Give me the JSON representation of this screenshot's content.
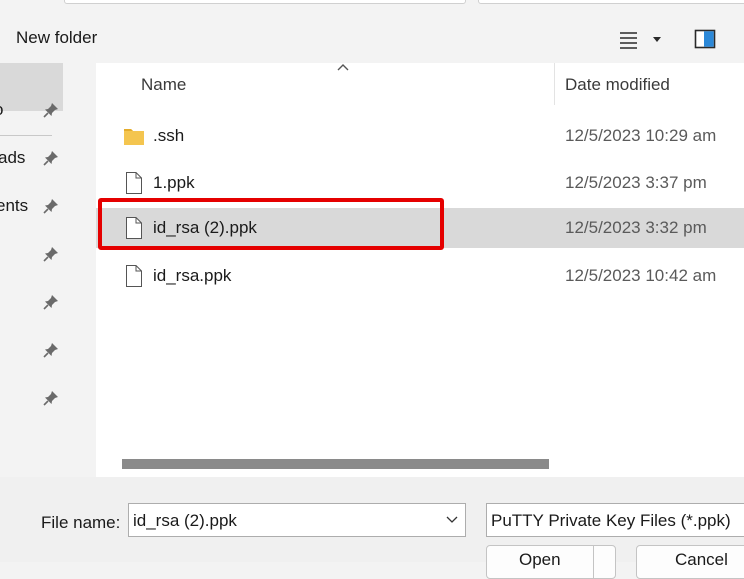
{
  "toolbar": {
    "new_folder_label": "New folder",
    "view_icon": "list-view-icon",
    "dropdown_icon": "caret-down-icon",
    "preview_pane_icon": "preview-pane-icon"
  },
  "nav": {
    "items": [
      {
        "label": "o",
        "icon": "pin-icon"
      },
      {
        "label": "ads",
        "icon": "pin-icon"
      },
      {
        "label": "ents",
        "icon": "pin-icon"
      },
      {
        "label": "",
        "icon": "pin-icon"
      },
      {
        "label": "",
        "icon": "pin-icon"
      },
      {
        "label": "",
        "icon": "pin-icon"
      },
      {
        "label": "",
        "icon": "pin-icon"
      }
    ]
  },
  "file_list": {
    "columns": [
      "Name",
      "Date modified"
    ],
    "rows": [
      {
        "name": ".ssh",
        "date": "12/5/2023 10:29 am",
        "icon": "folder-icon",
        "selected": false
      },
      {
        "name": "1.ppk",
        "date": "12/5/2023 3:37 pm",
        "icon": "file-icon",
        "selected": false
      },
      {
        "name": "id_rsa (2).ppk",
        "date": "12/5/2023 3:32 pm",
        "icon": "file-icon",
        "selected": true
      },
      {
        "name": "id_rsa.ppk",
        "date": "12/5/2023 10:42 am",
        "icon": "file-icon",
        "selected": false
      }
    ]
  },
  "bottom": {
    "file_name_label": "File name:",
    "file_name_value": "id_rsa (2).ppk",
    "file_type_value": "PuTTY Private Key Files (*.ppk)",
    "open_button": "Open",
    "cancel_button": "Cancel"
  },
  "colors": {
    "highlight": "#e50000",
    "selection": "#d9d9d9",
    "folder": "#f4c54f"
  }
}
